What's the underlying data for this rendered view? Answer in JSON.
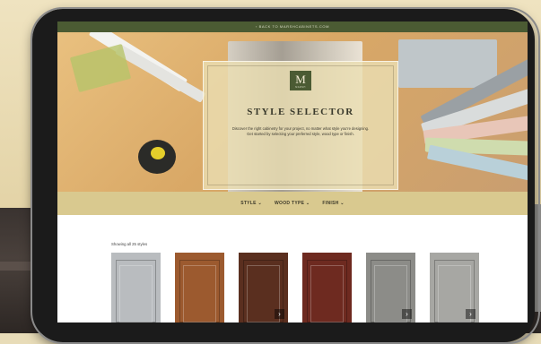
{
  "topbar": {
    "text": "‹ BACK TO MARSHCABINETS.COM"
  },
  "logo": {
    "letter": "M",
    "sub": "MARSH"
  },
  "hero": {
    "title": "STYLE SELECTOR",
    "description": "Discover the right cabinetry for your project, no matter what style you're designing. Get started by selecting your preferred style, wood type or finish."
  },
  "filters": [
    {
      "label": "STYLE ⌄"
    },
    {
      "label": "WOOD TYPE ⌄"
    },
    {
      "label": "FINISH ⌄"
    }
  ],
  "results": {
    "count_text": "Showing all 25 styles"
  },
  "products": [
    {
      "color": "#b9bcbf",
      "has_arrow": false
    },
    {
      "color": "#9c5a2f",
      "has_arrow": false
    },
    {
      "color": "#5a2f1f",
      "has_arrow": true
    },
    {
      "color": "#6e2a20",
      "has_arrow": false
    },
    {
      "color": "#8c8c88",
      "has_arrow": true
    },
    {
      "color": "#a7a7a3",
      "has_arrow": true
    }
  ],
  "arrow_glyph": "›",
  "colors": {
    "brand_green": "#4b5b33",
    "filter_bar": "#d9c98f",
    "panel": "#eadeb2"
  }
}
